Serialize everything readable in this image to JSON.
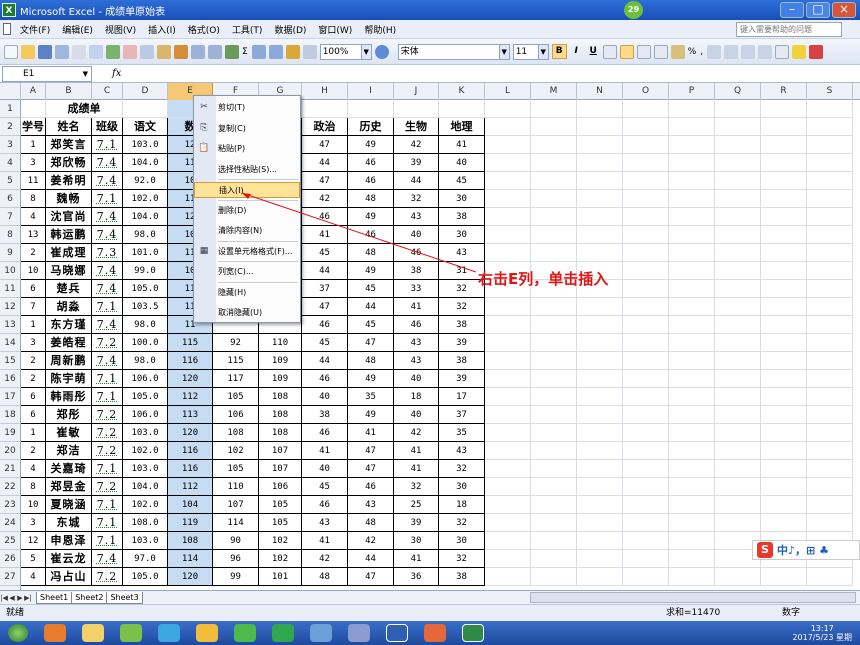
{
  "window": {
    "title": "Microsoft Excel - 成绩单原始表",
    "badge": "29"
  },
  "menu": {
    "items": [
      "文件(F)",
      "编辑(E)",
      "视图(V)",
      "插入(I)",
      "格式(O)",
      "工具(T)",
      "数据(D)",
      "窗口(W)",
      "帮助(H)"
    ],
    "help_placeholder": "键入需要帮助的问题"
  },
  "toolbar": {
    "zoom": "100%",
    "font": "宋体",
    "size": "11",
    "bold": "B",
    "italic": "I",
    "underline": "U"
  },
  "formula_bar": {
    "name_box": "E1",
    "fx": "fx",
    "content": ""
  },
  "columns": [
    "A",
    "B",
    "C",
    "D",
    "E",
    "F",
    "G",
    "H",
    "I",
    "J",
    "K",
    "L",
    "M",
    "N",
    "O",
    "P",
    "Q",
    "R",
    "S"
  ],
  "selected_column": "E",
  "sheet": {
    "title": "成绩单",
    "headers": [
      "学号",
      "姓名",
      "班级",
      "语文",
      "数",
      "",
      "",
      "政治",
      "历史",
      "生物",
      "地理"
    ],
    "rows": [
      {
        "rn": "3",
        "a": "1",
        "b": "郑笑言",
        "c": "7.1",
        "d": "103.0",
        "e": "12",
        "f": "",
        "g": "",
        "h": "47",
        "i": "49",
        "j": "42",
        "k": "41"
      },
      {
        "rn": "4",
        "a": "3",
        "b": "郑欣畅",
        "c": "7.4",
        "d": "104.0",
        "e": "11",
        "f": "",
        "g": "",
        "h": "44",
        "i": "46",
        "j": "39",
        "k": "40"
      },
      {
        "rn": "5",
        "a": "11",
        "b": "姜希明",
        "c": "7.4",
        "d": "92.0",
        "e": "10",
        "f": "",
        "g": "",
        "h": "47",
        "i": "46",
        "j": "44",
        "k": "45"
      },
      {
        "rn": "6",
        "a": "8",
        "b": "魏畅",
        "c": "7.1",
        "d": "102.0",
        "e": "11",
        "f": "",
        "g": "",
        "h": "42",
        "i": "48",
        "j": "32",
        "k": "30"
      },
      {
        "rn": "7",
        "a": "4",
        "b": "沈官尚",
        "c": "7.4",
        "d": "104.0",
        "e": "12",
        "f": "",
        "g": "",
        "h": "46",
        "i": "49",
        "j": "43",
        "k": "38"
      },
      {
        "rn": "8",
        "a": "13",
        "b": "韩运鹏",
        "c": "7.4",
        "d": "98.0",
        "e": "10",
        "f": "",
        "g": "",
        "h": "41",
        "i": "46",
        "j": "40",
        "k": "30"
      },
      {
        "rn": "9",
        "a": "2",
        "b": "崔成理",
        "c": "7.3",
        "d": "101.0",
        "e": "11",
        "f": "",
        "g": "",
        "h": "45",
        "i": "48",
        "j": "46",
        "k": "43"
      },
      {
        "rn": "10",
        "a": "10",
        "b": "马晓娜",
        "c": "7.4",
        "d": "99.0",
        "e": "10",
        "f": "",
        "g": "",
        "h": "44",
        "i": "49",
        "j": "38",
        "k": "31"
      },
      {
        "rn": "11",
        "a": "6",
        "b": "楚兵",
        "c": "7.4",
        "d": "105.0",
        "e": "11",
        "f": "",
        "g": "",
        "h": "37",
        "i": "45",
        "j": "33",
        "k": "32"
      },
      {
        "rn": "12",
        "a": "7",
        "b": "胡淼",
        "c": "7.1",
        "d": "103.5",
        "e": "11",
        "f": "",
        "g": "",
        "h": "47",
        "i": "44",
        "j": "41",
        "k": "32"
      },
      {
        "rn": "13",
        "a": "1",
        "b": "东方瑾",
        "c": "7.4",
        "d": "98.0",
        "e": "11",
        "f": "",
        "g": "",
        "h": "46",
        "i": "45",
        "j": "46",
        "k": "38"
      },
      {
        "rn": "14",
        "a": "3",
        "b": "姜皓程",
        "c": "7.2",
        "d": "100.0",
        "e": "115",
        "f": "92",
        "g": "110",
        "h": "45",
        "i": "47",
        "j": "43",
        "k": "39"
      },
      {
        "rn": "15",
        "a": "2",
        "b": "周新鹏",
        "c": "7.4",
        "d": "98.0",
        "e": "116",
        "f": "115",
        "g": "109",
        "h": "44",
        "i": "48",
        "j": "43",
        "k": "38"
      },
      {
        "rn": "16",
        "a": "2",
        "b": "陈宇萌",
        "c": "7.1",
        "d": "106.0",
        "e": "120",
        "f": "117",
        "g": "109",
        "h": "46",
        "i": "49",
        "j": "40",
        "k": "39"
      },
      {
        "rn": "17",
        "a": "6",
        "b": "韩雨彤",
        "c": "7.1",
        "d": "105.0",
        "e": "112",
        "f": "105",
        "g": "108",
        "h": "40",
        "i": "35",
        "j": "18",
        "k": "17"
      },
      {
        "rn": "18",
        "a": "6",
        "b": "郑彤",
        "c": "7.2",
        "d": "106.0",
        "e": "113",
        "f": "106",
        "g": "108",
        "h": "38",
        "i": "49",
        "j": "40",
        "k": "37"
      },
      {
        "rn": "19",
        "a": "1",
        "b": "崔敏",
        "c": "7.2",
        "d": "103.0",
        "e": "120",
        "f": "108",
        "g": "108",
        "h": "46",
        "i": "41",
        "j": "42",
        "k": "35"
      },
      {
        "rn": "20",
        "a": "2",
        "b": "郑洁",
        "c": "7.2",
        "d": "102.0",
        "e": "116",
        "f": "102",
        "g": "107",
        "h": "41",
        "i": "47",
        "j": "41",
        "k": "43"
      },
      {
        "rn": "21",
        "a": "4",
        "b": "关嘉琦",
        "c": "7.1",
        "d": "103.0",
        "e": "116",
        "f": "105",
        "g": "107",
        "h": "40",
        "i": "47",
        "j": "41",
        "k": "32"
      },
      {
        "rn": "22",
        "a": "8",
        "b": "郑昱金",
        "c": "7.2",
        "d": "104.0",
        "e": "112",
        "f": "110",
        "g": "106",
        "h": "45",
        "i": "46",
        "j": "32",
        "k": "30"
      },
      {
        "rn": "23",
        "a": "10",
        "b": "夏晓涵",
        "c": "7.1",
        "d": "102.0",
        "e": "104",
        "f": "107",
        "g": "105",
        "h": "46",
        "i": "43",
        "j": "25",
        "k": "18"
      },
      {
        "rn": "24",
        "a": "3",
        "b": "东城",
        "c": "7.1",
        "d": "108.0",
        "e": "119",
        "f": "114",
        "g": "105",
        "h": "43",
        "i": "48",
        "j": "39",
        "k": "32"
      },
      {
        "rn": "25",
        "a": "12",
        "b": "申恩泽",
        "c": "7.1",
        "d": "103.0",
        "e": "108",
        "f": "90",
        "g": "102",
        "h": "41",
        "i": "42",
        "j": "30",
        "k": "30"
      },
      {
        "rn": "26",
        "a": "5",
        "b": "崔云龙",
        "c": "7.4",
        "d": "97.0",
        "e": "114",
        "f": "96",
        "g": "102",
        "h": "42",
        "i": "44",
        "j": "41",
        "k": "32"
      },
      {
        "rn": "27",
        "a": "4",
        "b": "冯占山",
        "c": "7.2",
        "d": "105.0",
        "e": "120",
        "f": "99",
        "g": "101",
        "h": "48",
        "i": "47",
        "j": "36",
        "k": "38"
      }
    ]
  },
  "context_menu": {
    "items": [
      "剪切(T)",
      "复制(C)",
      "粘贴(P)",
      "选择性粘贴(S)...",
      "插入(I)",
      "删除(D)",
      "清除内容(N)",
      "设置单元格格式(F)...",
      "列宽(C)...",
      "隐藏(H)",
      "取消隐藏(U)"
    ],
    "highlighted": "插入(I)"
  },
  "annotation": "右击E列，单击插入",
  "sheet_tabs": [
    "Sheet1",
    "Sheet2",
    "Sheet3"
  ],
  "status": {
    "ready": "就绪",
    "sum": "求和=11470",
    "mode": "数字"
  },
  "clock": {
    "time": "13:17",
    "date": "2017/5/23 星期"
  },
  "ime": {
    "logo": "S",
    "text": "中♪，⊞ ♣"
  },
  "colors": {
    "accent": "#1a4fb8",
    "annotation": "#e21515",
    "selected_col": "#c6dcf3",
    "highlight": "#ffe39a"
  }
}
